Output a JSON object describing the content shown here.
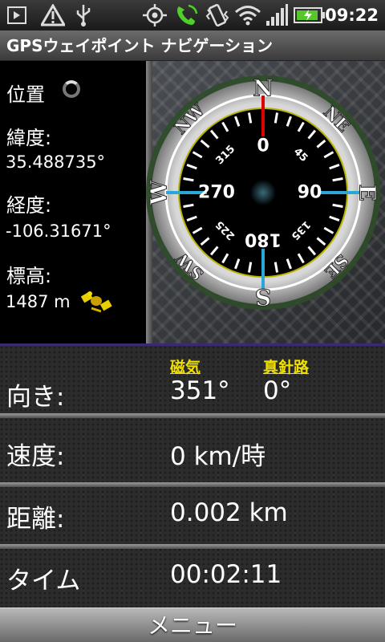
{
  "status_bar": {
    "time": "09:22",
    "icons": [
      "download-icon",
      "alert-icon",
      "usb-icon",
      "gps-icon",
      "phone-icon",
      "vibrate-icon",
      "wifi-icon",
      "signal-icon",
      "battery-charging-icon"
    ]
  },
  "title_bar": {
    "title": "GPSウェイポイント ナビゲーション"
  },
  "info_panel": {
    "position_label": "位置",
    "latitude_label": "緯度:",
    "latitude_value": "35.488735°",
    "longitude_label": "経度:",
    "longitude_value": "-106.31671°",
    "elevation_label": "標高:",
    "elevation_value": "1487 m"
  },
  "compass": {
    "cardinals": {
      "n": "N",
      "ne": "NE",
      "e": "E",
      "se": "SE",
      "s": "S",
      "sw": "SW",
      "w": "W",
      "nw": "NW"
    },
    "dial_numbers": [
      "0",
      "45",
      "90",
      "135",
      "180",
      "225",
      "270",
      "315"
    ],
    "heading_deg": 0,
    "colors": {
      "north": "#e00000",
      "cardinal_ticks": "#29a8d8",
      "ordinal_ticks": "#f0e000",
      "dial": "#000000",
      "ring_glow": "#3f6b38"
    }
  },
  "readings": {
    "heading_label": "向き:",
    "magnetic_label": "磁気",
    "magnetic_value": "351°",
    "true_course_label": "真針路",
    "true_course_value": "0°",
    "speed_label": "速度:",
    "speed_value": "0 km/時",
    "distance_label": "距離:",
    "distance_value": "0.002 km",
    "time_label": "タイム",
    "time_value": "00:02:11"
  },
  "menu": {
    "label": "メニュー"
  }
}
